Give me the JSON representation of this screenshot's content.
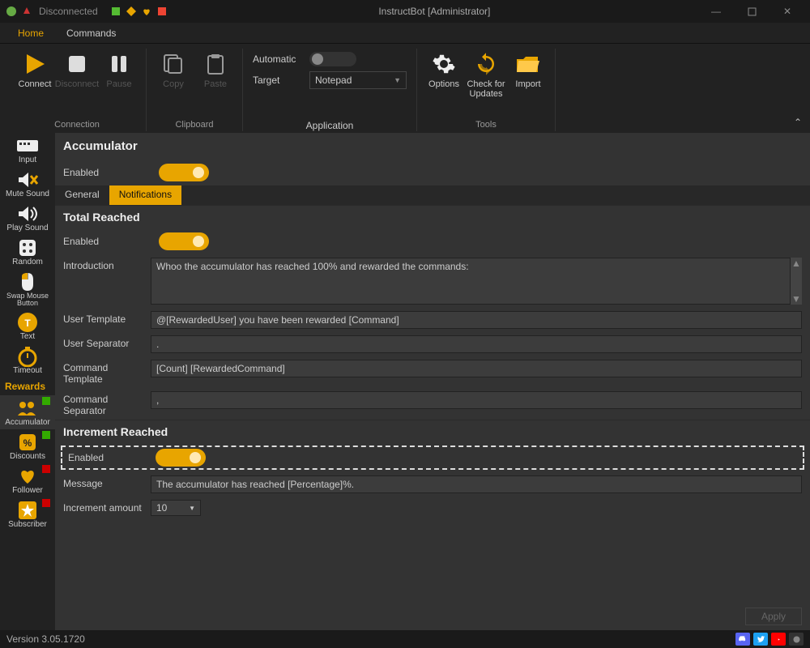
{
  "titlebar": {
    "status": "Disconnected",
    "title": "InstructBot [Administrator]"
  },
  "menu": {
    "home": "Home",
    "commands": "Commands"
  },
  "ribbon": {
    "connect": "Connect",
    "disconnect": "Disconnect",
    "pause": "Pause",
    "copy": "Copy",
    "paste": "Paste",
    "automatic": "Automatic",
    "target": "Target",
    "target_value": "Notepad",
    "options": "Options",
    "check": "Check for\nUpdates",
    "import": "Import",
    "g_connection": "Connection",
    "g_clipboard": "Clipboard",
    "g_application": "Application",
    "g_tools": "Tools"
  },
  "sidebar": {
    "hdr_rewards": "Rewards",
    "input": "Input",
    "mute": "Mute Sound",
    "play": "Play Sound",
    "random": "Random",
    "swap": "Swap Mouse\nButton",
    "text": "Text",
    "timeout": "Timeout",
    "accumulator": "Accumulator",
    "discounts": "Discounts",
    "follower": "Follower",
    "subscriber": "Subscriber"
  },
  "content": {
    "title": "Accumulator",
    "enabled": "Enabled",
    "tab_general": "General",
    "tab_notifications": "Notifications",
    "total_reached": "Total Reached",
    "introduction": "Introduction",
    "introduction_val": "Whoo the accumulator has reached 100% and rewarded the commands:",
    "user_template": "User Template",
    "user_template_val": "@[RewardedUser] you have been rewarded [Command]",
    "user_sep": "User Separator",
    "user_sep_val": ".",
    "cmd_template": "Command Template",
    "cmd_template_val": "[Count] [RewardedCommand]",
    "cmd_sep": "Command Separator",
    "cmd_sep_val": ",",
    "increment_reached": "Increment Reached",
    "message": "Message",
    "message_val": "The accumulator has reached [Percentage]%.",
    "increment_amount": "Increment amount",
    "increment_amount_val": "10",
    "apply": "Apply"
  },
  "statusbar": {
    "version": "Version 3.05.1720"
  }
}
